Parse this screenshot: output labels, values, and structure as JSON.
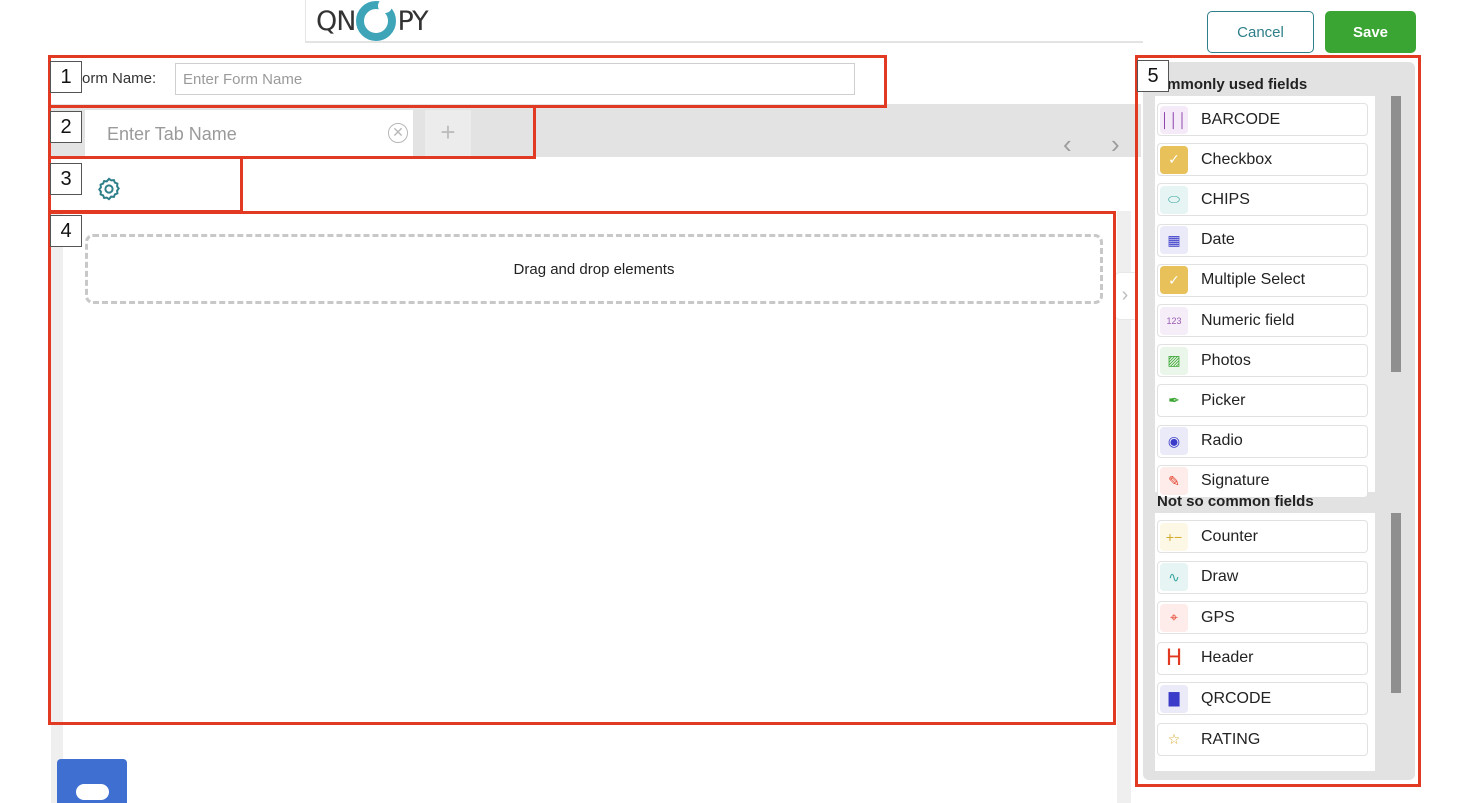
{
  "header": {
    "logo_left": "QN",
    "logo_right": "PY",
    "cancel_label": "Cancel",
    "save_label": "Save"
  },
  "form": {
    "name_label": "orm Name:",
    "name_placeholder": "Enter Form Name"
  },
  "tabs": {
    "tab_placeholder": "Enter Tab Name",
    "close_glyph": "✕",
    "add_glyph": "+",
    "prev_glyph": "‹",
    "next_glyph": "›"
  },
  "canvas": {
    "dropzone_text": "Drag and drop elements",
    "collapse_glyph": "›"
  },
  "panel": {
    "common_title": "ommonly used fields",
    "common_fields": [
      {
        "label": "BARCODE",
        "icon": "barcode-icon",
        "color": "#8e44ad",
        "bg": "#f5ebf8",
        "glyph": "│││"
      },
      {
        "label": "Checkbox",
        "icon": "checkbox-icon",
        "color": "#ffffff",
        "bg": "#e8c15a",
        "glyph": "✓"
      },
      {
        "label": "CHIPS",
        "icon": "chips-icon",
        "color": "#3aa6a0",
        "bg": "#e6f5f4",
        "glyph": "⬭"
      },
      {
        "label": "Date",
        "icon": "calendar-icon",
        "color": "#3b3bc9",
        "bg": "#eaeaf8",
        "glyph": "▦"
      },
      {
        "label": "Multiple Select",
        "icon": "multiple-select-icon",
        "color": "#ffffff",
        "bg": "#e8c15a",
        "glyph": "✓"
      },
      {
        "label": "Numeric field",
        "icon": "numeric-icon",
        "color": "#9b59b6",
        "bg": "#f5eef8",
        "glyph": "123"
      },
      {
        "label": "Photos",
        "icon": "photo-icon",
        "color": "#3aa533",
        "bg": "#eaf6e9",
        "glyph": "▨"
      },
      {
        "label": "Picker",
        "icon": "picker-icon",
        "color": "#3aa533",
        "bg": "#ffffff",
        "glyph": "✒"
      },
      {
        "label": "Radio",
        "icon": "radio-icon",
        "color": "#3b3bc9",
        "bg": "#eaeaf8",
        "glyph": "◉"
      },
      {
        "label": "Signature",
        "icon": "signature-icon",
        "color": "#e23a22",
        "bg": "#fdecea",
        "glyph": "✎"
      }
    ],
    "uncommon_title": "Not so common fields",
    "uncommon_fields": [
      {
        "label": "Counter",
        "icon": "counter-icon",
        "color": "#d4a92a",
        "bg": "#fdf7e6",
        "glyph": "+−"
      },
      {
        "label": "Draw",
        "icon": "draw-icon",
        "color": "#3aa6a0",
        "bg": "#e6f5f4",
        "glyph": "∿"
      },
      {
        "label": "GPS",
        "icon": "gps-icon",
        "color": "#e23a22",
        "bg": "#fdecea",
        "glyph": "⌖"
      },
      {
        "label": "Header",
        "icon": "header-icon",
        "color": "#e23a22",
        "bg": "#ffffff",
        "glyph": "H"
      },
      {
        "label": "QRCODE",
        "icon": "qrcode-icon",
        "color": "#3b3bc9",
        "bg": "#eaeaf8",
        "glyph": "▇"
      },
      {
        "label": "RATING",
        "icon": "star-icon",
        "color": "#d4a92a",
        "bg": "#ffffff",
        "glyph": "☆"
      }
    ]
  },
  "annotations": [
    "1",
    "2",
    "3",
    "4",
    "5"
  ],
  "colors": {
    "accent_teal": "#2e7f89",
    "save_green": "#3aa533",
    "annotation_red": "#e23a22",
    "logo_teal": "#3ea5b9"
  }
}
